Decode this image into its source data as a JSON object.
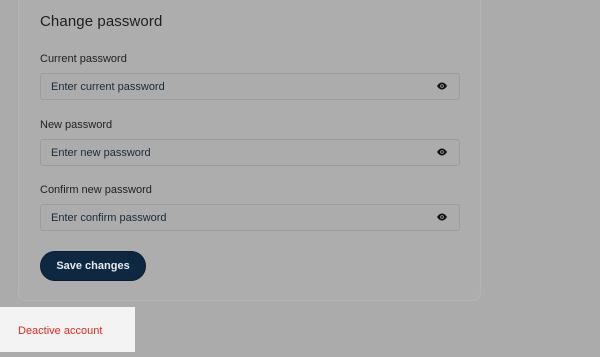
{
  "form": {
    "title": "Change password",
    "fields": [
      {
        "label": "Current password",
        "placeholder": "Enter current password",
        "value": "",
        "icon": "eye-icon"
      },
      {
        "label": "New password",
        "placeholder": "Enter new password",
        "value": "",
        "icon": "eye-icon"
      },
      {
        "label": "Confirm new password",
        "placeholder": "Enter confirm password",
        "value": "",
        "icon": "eye-icon"
      }
    ],
    "save_label": "Save changes"
  },
  "account": {
    "deactivate_label": "Deactive account"
  },
  "colors": {
    "overlay": "#ababab",
    "button": "#0f2841",
    "danger": "#e02a1f"
  }
}
